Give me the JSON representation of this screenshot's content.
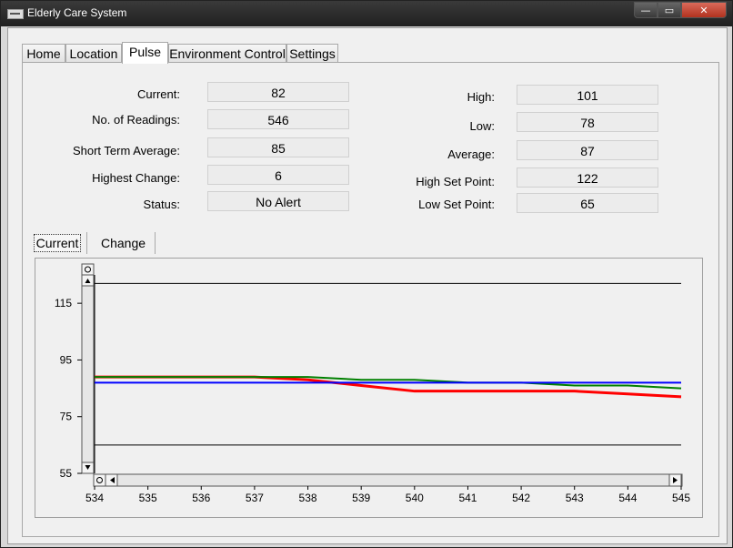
{
  "window": {
    "title": "Elderly Care System",
    "controls": {
      "minimize": "—",
      "maximize": "▭",
      "close": "✕"
    }
  },
  "tabs": [
    {
      "label": "Home"
    },
    {
      "label": "Location"
    },
    {
      "label": "Pulse",
      "active": true
    },
    {
      "label": "Environment Control"
    },
    {
      "label": "Settings"
    }
  ],
  "stats_left": {
    "current_label": "Current:",
    "current": "82",
    "readings_label": "No. of Readings:",
    "readings": "546",
    "short_avg_label": "Short Term Average:",
    "short_avg": "85",
    "highest_change_label": "Highest Change:",
    "highest_change": "6",
    "status_label": "Status:",
    "status": "No Alert"
  },
  "stats_right": {
    "high_label": "High:",
    "high": "101",
    "low_label": "Low:",
    "low": "78",
    "average_label": "Average:",
    "average": "87",
    "high_set_label": "High Set Point:",
    "high_set": "122",
    "low_set_label": "Low Set Point:",
    "low_set": "65"
  },
  "chart_tabs": [
    {
      "label": "Current",
      "active": true
    },
    {
      "label": "Change"
    }
  ],
  "chart_data": {
    "type": "line",
    "x": [
      534,
      535,
      536,
      537,
      538,
      539,
      540,
      541,
      542,
      543,
      544,
      545
    ],
    "ylim": [
      55,
      125
    ],
    "yticks": [
      55,
      75,
      95,
      115
    ],
    "xticks": [
      534,
      535,
      536,
      537,
      538,
      539,
      540,
      541,
      542,
      543,
      544,
      545
    ],
    "series": [
      {
        "color": "#ff0000",
        "values": [
          89,
          89,
          89,
          89,
          88,
          86,
          84,
          84,
          84,
          84,
          83,
          82
        ]
      },
      {
        "color": "#008000",
        "values": [
          89,
          89,
          89,
          89,
          89,
          88,
          88,
          87,
          87,
          86,
          86,
          85
        ]
      },
      {
        "color": "#0000ff",
        "values": [
          87,
          87,
          87,
          87,
          87,
          87,
          87,
          87,
          87,
          87,
          87,
          87
        ]
      },
      {
        "color": "#000000",
        "values": [
          122,
          122,
          122,
          122,
          122,
          122,
          122,
          122,
          122,
          122,
          122,
          122
        ]
      },
      {
        "color": "#000000",
        "values": [
          65,
          65,
          65,
          65,
          65,
          65,
          65,
          65,
          65,
          65,
          65,
          65
        ]
      }
    ]
  }
}
